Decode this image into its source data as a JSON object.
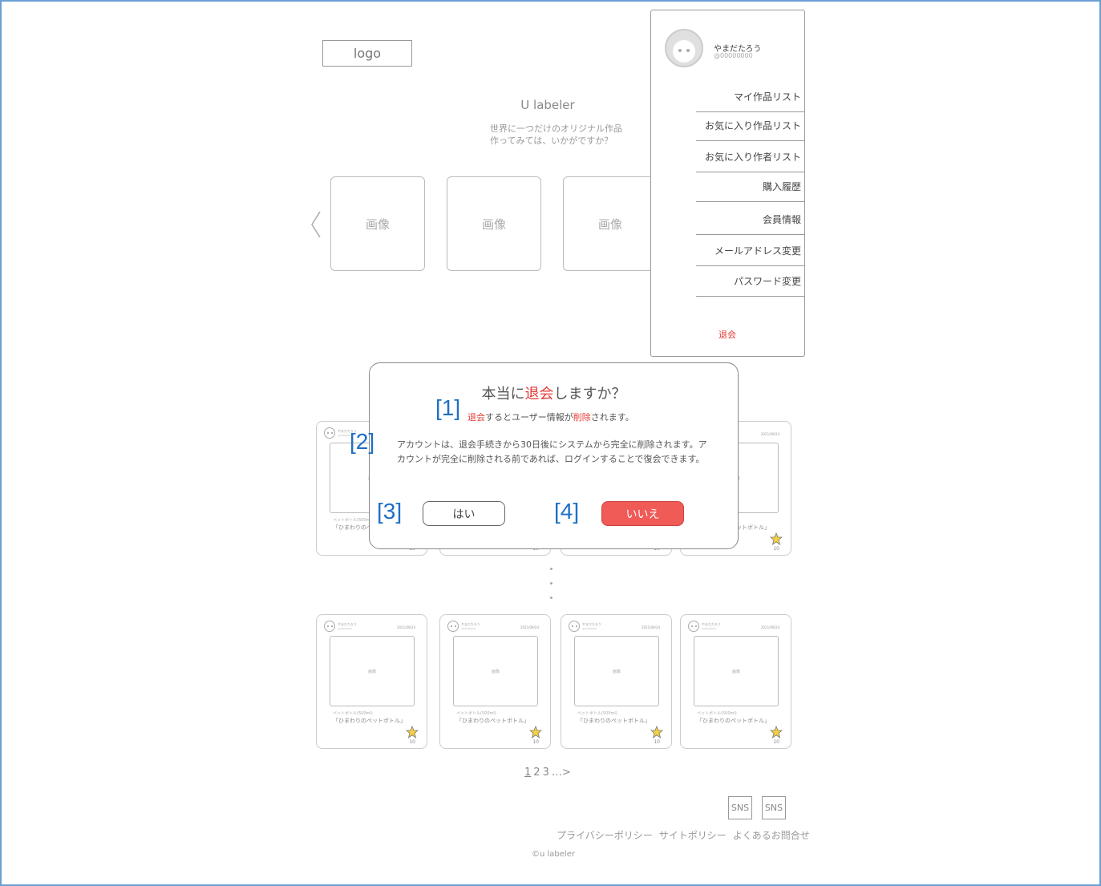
{
  "header": {
    "logo": "logo"
  },
  "hero": {
    "title": "U labeler",
    "tagline_line1": "世界に一つだけのオリジナル作品",
    "tagline_line2": "作ってみては、いかがですか？"
  },
  "carousel": {
    "items": [
      "画像",
      "画像",
      "画像"
    ]
  },
  "card": {
    "username": "やまだたろう",
    "user_id": "@00000000",
    "date": "2021/09/24",
    "image": "画像",
    "category": "ペットボトル(500ml)",
    "product": "「ひまわりのペットボトル」",
    "fav_count": "10"
  },
  "pagination": {
    "pages": [
      "1",
      "2",
      "3"
    ],
    "more": "…>"
  },
  "footer": {
    "sns": [
      "SNS",
      "SNS"
    ],
    "links": [
      "プライバシーポリシー",
      "サイトポリシー",
      "よくあるお問合せ"
    ],
    "copyright": "©u labeler"
  },
  "menu": {
    "user_name": "やまだたろう",
    "user_id": "@00000000",
    "items": [
      "マイ作品リスト",
      "お気に入り作品リスト",
      "お気に入り作者リスト",
      "購入履歴",
      "会員情報",
      "メールアドレス変更",
      "パスワード変更"
    ],
    "withdraw": "退会"
  },
  "dialog": {
    "title_before": "本当に",
    "title_highlight": "退会",
    "title_after": "しますか？",
    "sub_highlight1": "退会",
    "sub_mid": "するとユーザー情報が",
    "sub_highlight2": "削除",
    "sub_after": "されます。",
    "body": "アカウントは、退会手続きから30日後にシステムから完全に削除されます。アカウントが完全に削除される前であれば、ログインすることで復会できます。",
    "yes_label": "はい",
    "no_label": "いいえ"
  },
  "annotations": [
    "[1]",
    "[2]",
    "[3]",
    "[4]"
  ],
  "colors": {
    "accent_red": "#e53935",
    "button_red": "#f05a57",
    "annotation_blue": "#1e6fc4",
    "frame_blue": "#6a9fd4"
  }
}
